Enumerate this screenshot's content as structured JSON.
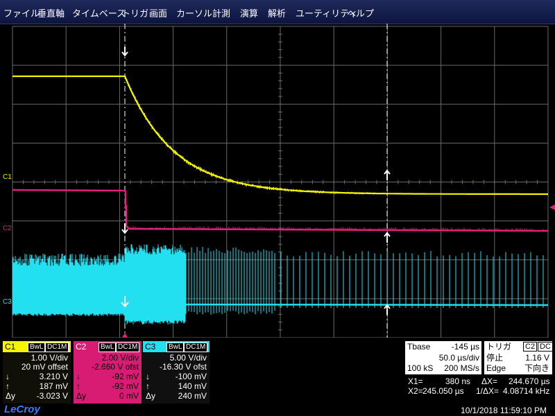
{
  "menu": {
    "items": [
      "ファイル",
      "垂直軸",
      "タイムベース",
      "トリガ",
      "画面",
      "カーソル",
      "計測",
      "演算",
      "解析",
      "ユーティリティ",
      "ヘルプ"
    ]
  },
  "channels": {
    "c1": {
      "name": "C1",
      "badge1": "BwL",
      "badge2": "DC1M",
      "vdiv": "1.00 V/div",
      "offset": "20 mV offset",
      "down_label": "↓",
      "down_val": "3.210 V",
      "up_label": "↑",
      "up_val": "187 mV",
      "dy_label": "Δy",
      "dy_val": "-3.023 V",
      "color": "#f5f500",
      "trace_label": "C1"
    },
    "c2": {
      "name": "C2",
      "badge1": "BwL",
      "badge2": "DC1M",
      "vdiv": "2.00 V/div",
      "offset": "-2.660 V ofst",
      "down_label": "↓",
      "down_val": "-92 mV",
      "up_label": "↑",
      "up_val": "-92 mV",
      "dy_label": "Δy",
      "dy_val": "0 mV",
      "color": "#e0207a",
      "trace_label": "C2"
    },
    "c3": {
      "name": "C3",
      "badge1": "BwL",
      "badge2": "DC1M",
      "vdiv": "5.00 V/div",
      "offset": "-16.30 V ofst",
      "down_label": "↓",
      "down_val": "-100 mV",
      "up_label": "↑",
      "up_val": "140 mV",
      "dy_label": "Δy",
      "dy_val": "240 mV",
      "color": "#22e0f0",
      "trace_label": "C3"
    }
  },
  "timebase": {
    "label": "Tbase",
    "delay": "-145 µs",
    "tdiv": "50.0 µs/div",
    "samples": "100 kS",
    "rate": "200 MS/s"
  },
  "trigger": {
    "label": "トリガ",
    "source": "C2",
    "coupling": "DC",
    "mode": "停止",
    "level": "1.16 V",
    "type": "Edge",
    "slope": "下向き"
  },
  "cursors": {
    "x1_label": "X1=",
    "x1_val": "380 ns",
    "x2_label": "X2=",
    "x2_val": "245.050 µs",
    "dx_label": "ΔX=",
    "dx_val": "244.670 µs",
    "inv_dx_label": "1/ΔX=",
    "inv_dx_val": "4.08714 kHz"
  },
  "brand": "LeCroy",
  "timestamp": "10/1/2018 11:59:10 PM",
  "colors": {
    "grid": "#6a6a6a",
    "background": "#000000",
    "menubar": "#16205a",
    "logo": "#3d7bff"
  }
}
